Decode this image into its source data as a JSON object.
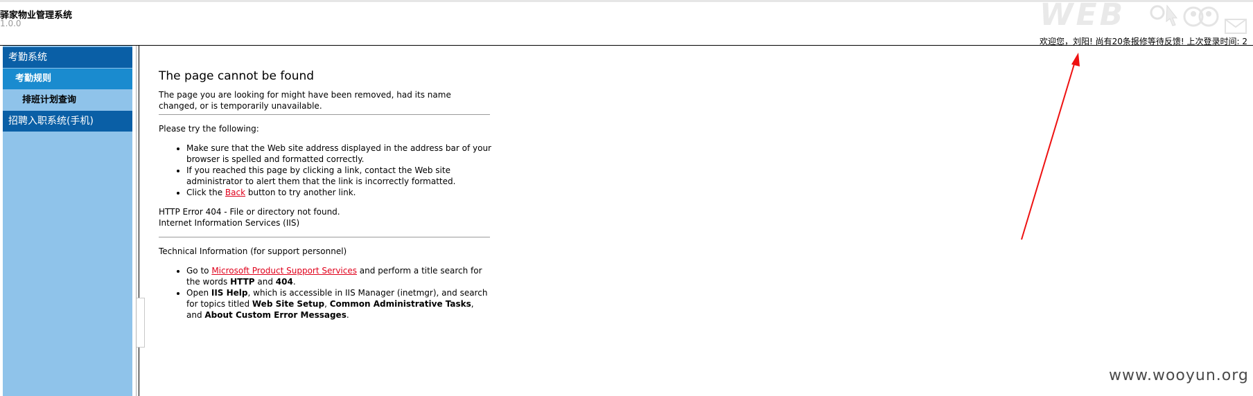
{
  "header": {
    "app_title": "驿家物业管理系统",
    "version": "1.0.0",
    "banner_text": "WEB",
    "welcome_text": "欢迎您，刘阳! 尚有20条报修等待反馈! 上次登录时间: 2"
  },
  "sidebar": {
    "groups": [
      {
        "label": "考勤系统",
        "items": [
          {
            "label": "考勤规则",
            "active": true
          },
          {
            "label": "排班计划查询",
            "active": false
          }
        ]
      },
      {
        "label": "招聘入职系统(手机)"
      }
    ]
  },
  "error_page": {
    "title": "The page cannot be found",
    "description": "The page you are looking for might have been removed, had its name changed, or is temporarily unavailable.",
    "try_heading": "Please try the following:",
    "try_list": {
      "item1": "Make sure that the Web site address displayed in the address bar of your browser is spelled and formatted correctly.",
      "item2": "If you reached this page by clicking a link, contact the Web site administrator to alert them that the link is incorrectly formatted.",
      "item3_prefix": "Click the ",
      "item3_link": "Back",
      "item3_suffix": " button to try another link."
    },
    "http_error": "HTTP Error 404 - File or directory not found.",
    "server": "Internet Information Services (IIS)",
    "tech_heading": "Technical Information (for support personnel)",
    "tech_list": {
      "item1_prefix": "Go to ",
      "item1_link": "Microsoft Product Support Services",
      "item1_mid": " and perform a title search for the words ",
      "item1_b1": "HTTP",
      "item1_and": " and ",
      "item1_b2": "404",
      "item1_end": ".",
      "item2_prefix": "Open ",
      "item2_b1": "IIS Help",
      "item2_mid": ", which is accessible in IIS Manager (inetmgr), and search for topics titled ",
      "item2_b2": "Web Site Setup",
      "item2_comma": ", ",
      "item2_b3": "Common Administrative Tasks",
      "item2_and": ", and ",
      "item2_b4": "About Custom Error Messages",
      "item2_end": "."
    }
  },
  "watermark": "www.wooyun.org",
  "colors": {
    "nav_group_bg": "#0a5fa6",
    "nav_active_bg": "#1a8bcf",
    "sidebar_bg": "#8fc3ea",
    "link": "#e0001b",
    "annotation_arrow": "#ee1111"
  }
}
